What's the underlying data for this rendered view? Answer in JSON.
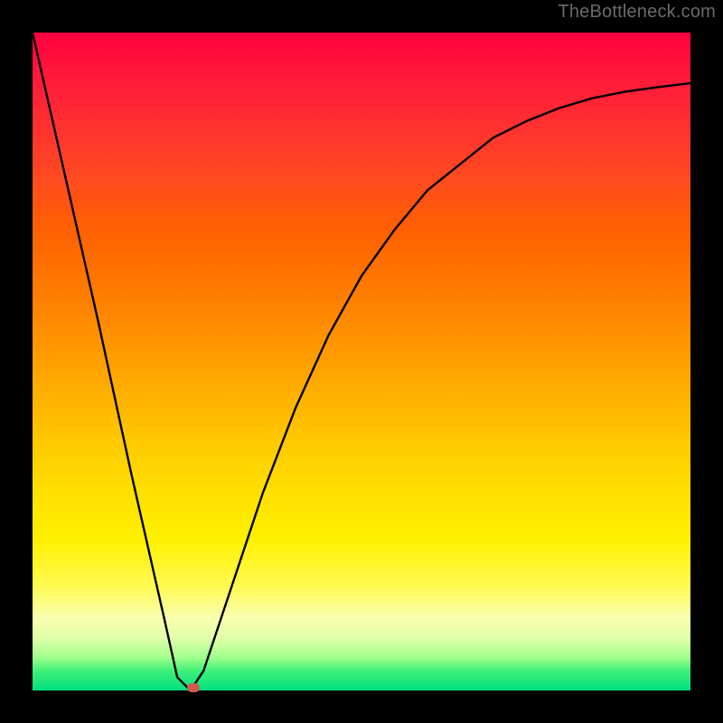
{
  "watermark": "TheBottleneck.com",
  "chart_data": {
    "type": "line",
    "title": "",
    "xlabel": "",
    "ylabel": "",
    "xlim": [
      0,
      100
    ],
    "ylim": [
      0,
      100
    ],
    "grid": false,
    "legend": false,
    "series": [
      {
        "name": "curve",
        "x": [
          0,
          5,
          10,
          15,
          20,
          22,
          24,
          26,
          30,
          35,
          40,
          45,
          50,
          55,
          60,
          65,
          70,
          75,
          80,
          85,
          90,
          95,
          100
        ],
        "values": [
          100,
          78,
          56,
          33,
          11,
          2,
          0,
          3,
          15,
          30,
          43,
          54,
          63,
          70,
          76,
          80,
          84,
          86.5,
          88.5,
          90,
          91,
          91.7,
          92.3
        ]
      }
    ],
    "marker": {
      "x": 24.5,
      "y": 0
    },
    "colors": {
      "top": "#ff0040",
      "bottom": "#00e080",
      "curve": "#000000",
      "marker": "#cf5b4a",
      "frame": "#000000"
    }
  }
}
